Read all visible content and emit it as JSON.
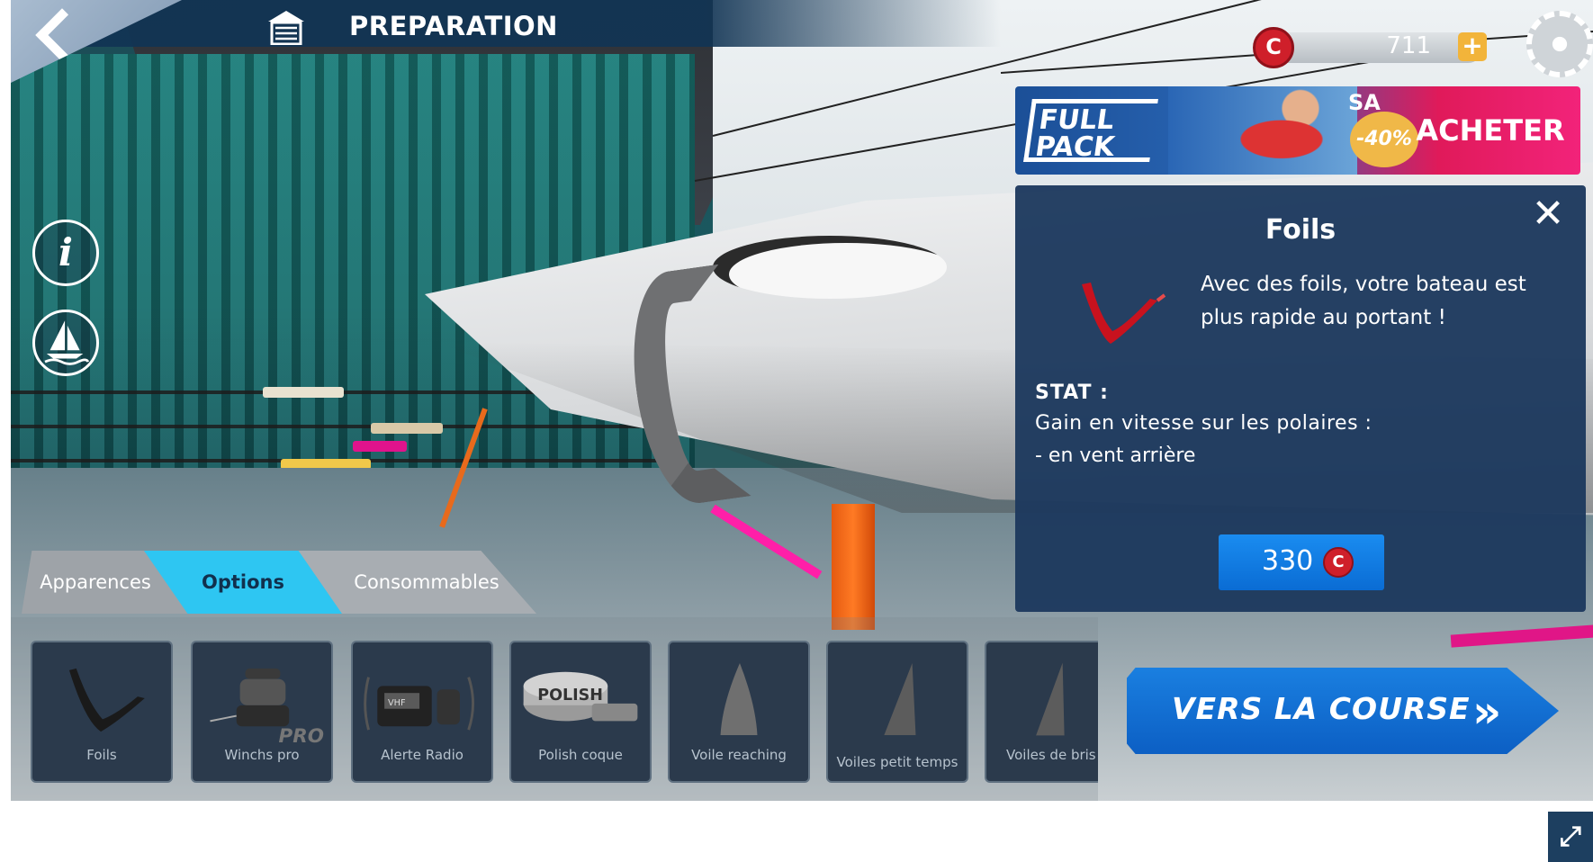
{
  "header": {
    "title": "PREPARATION"
  },
  "currency": {
    "coin_letter": "C",
    "amount": "711",
    "plus_label": "+"
  },
  "promo": {
    "logo_line1": "FULL",
    "logo_line2": "PACK",
    "side_text": "SA",
    "discount": "-40%",
    "buy_label": "ACHETER"
  },
  "panel": {
    "title": "Foils",
    "description": "Avec des foils, votre bateau est plus rapide au portant !",
    "stat_label": "STAT :",
    "stat_line1": "Gain en vitesse sur les polaires  :",
    "stat_line2": "- en vent arrière",
    "price": "330",
    "price_coin": "C",
    "close_symbol": "✕"
  },
  "left_icons": {
    "info_symbol": "i"
  },
  "tabs": [
    {
      "label": "Apparences"
    },
    {
      "label": "Options"
    },
    {
      "label": "Consommables"
    }
  ],
  "items": [
    {
      "label": "Foils",
      "icon": "foil-icon"
    },
    {
      "label": "Winchs pro",
      "icon": "winch-icon",
      "badge": "PRO"
    },
    {
      "label": "Alerte Radio",
      "icon": "radio-icon",
      "badge": "VHF"
    },
    {
      "label": "Polish coque",
      "icon": "polish-icon",
      "badge": "POLISH"
    },
    {
      "label": "Voile reaching",
      "icon": "reaching-sail-icon"
    },
    {
      "label": "Voiles petit temps",
      "icon": "light-sail-icon"
    },
    {
      "label": "Voiles de bris",
      "icon": "storm-sail-icon"
    }
  ],
  "race_button": {
    "label": "VERS LA COURSE",
    "arrows": "»"
  },
  "colors": {
    "accent": "#2ec6f2",
    "panel": "#1d395e",
    "race": "#0c5fc4",
    "coin": "#cf1f2a",
    "promo_pink": "#f2237a"
  }
}
